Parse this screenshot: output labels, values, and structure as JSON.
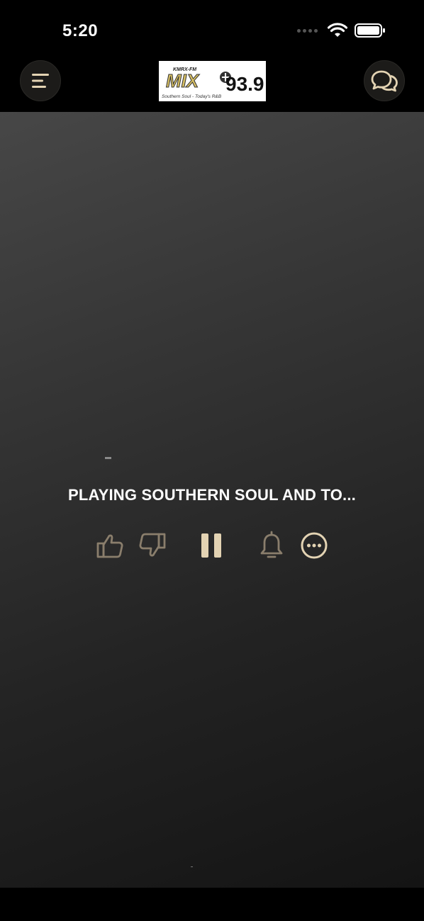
{
  "status_bar": {
    "time": "5:20"
  },
  "header": {
    "logo": {
      "call_sign": "KMRX-FM",
      "brand": "MIX",
      "frequency": "93.9",
      "tagline": "Southern Soul - Today's R&B"
    }
  },
  "player": {
    "artist": "-",
    "title": "PLAYING SOUTHERN SOUL AND TO...",
    "is_playing": true
  },
  "icons": {
    "menu": "menu-icon",
    "chat": "chat-icon",
    "thumbs_up": "thumbs-up-icon",
    "thumbs_down": "thumbs-down-icon",
    "pause": "pause-icon",
    "bell": "bell-icon",
    "more": "more-icon"
  },
  "colors": {
    "accent": "#e3d3b3",
    "accent_muted": "#8a7e6c",
    "button_bg": "#1c1b19",
    "text": "#ffffff"
  }
}
